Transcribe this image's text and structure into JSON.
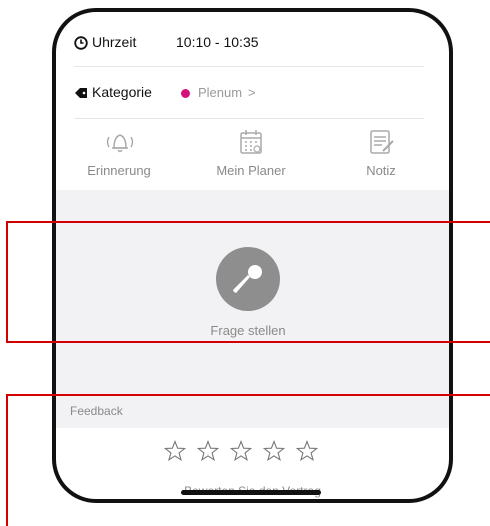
{
  "time": {
    "label": "Uhrzeit",
    "value": "10:10 - 10:35",
    "icon": "clock-icon"
  },
  "category": {
    "label": "Kategorie",
    "value": "Plenum",
    "chevron": ">",
    "dot_color": "#d4117a",
    "icon": "tag-icon"
  },
  "actions": [
    {
      "label": "Erinnerung",
      "icon": "bell-icon"
    },
    {
      "label": "Mein Planer",
      "icon": "calendar-icon"
    },
    {
      "label": "Notiz",
      "icon": "note-icon"
    }
  ],
  "question": {
    "label": "Frage stellen",
    "icon": "microphone-icon"
  },
  "feedback": {
    "header": "Feedback",
    "rating_stars": 5,
    "rating_value": 0,
    "prompt": "Bewerten Sie den Vortrag"
  },
  "colors": {
    "highlight_border": "#d40000",
    "section_background": "#f2f2f4"
  }
}
